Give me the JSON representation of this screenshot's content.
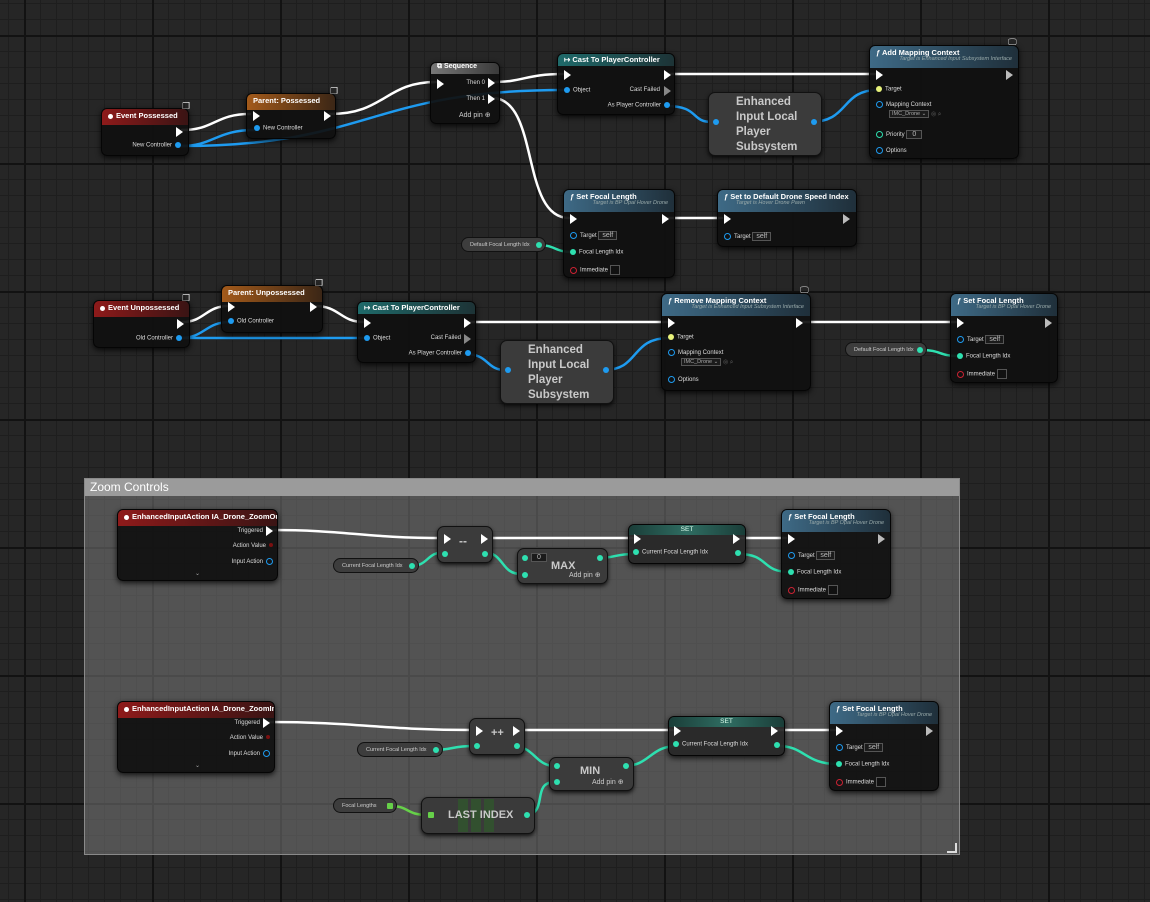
{
  "comment": {
    "title": "Zoom Controls"
  },
  "icons": {
    "event_corner": "blueprint-doc-icon",
    "network": "monitor-icon"
  },
  "possessed": {
    "event": {
      "title": "Event Possessed",
      "pin_new_controller": "New Controller"
    },
    "parent": {
      "title": "Parent: Possessed",
      "pin_new_controller": "New Controller"
    },
    "sequence": {
      "title": "Sequence",
      "then0": "Then 0",
      "then1": "Then 1",
      "add_pin": "Add pin"
    },
    "cast": {
      "title": "Cast To PlayerController",
      "object": "Object",
      "cast_failed": "Cast Failed",
      "as_pc": "As Player Controller"
    },
    "subsystem": {
      "label": "Enhanced Input Local Player Subsystem"
    },
    "add_mapping": {
      "title": "Add Mapping Context",
      "subtitle": "Target is Enhanced Input Subsystem Interface",
      "target": "Target",
      "mapping_context": "Mapping Context",
      "mapping_value": "IMC_Drone",
      "priority": "Priority",
      "priority_value": "0",
      "options": "Options"
    },
    "set_focal": {
      "title": "Set Focal Length",
      "subtitle": "Target is BP Opal Hover Drone",
      "target": "Target",
      "target_value": "self",
      "focal_idx": "Focal Length Idx",
      "immediate": "Immediate"
    },
    "default_var": {
      "label": "Default Focal Length Idx"
    },
    "set_speed": {
      "title": "Set to Default Drone Speed Index",
      "subtitle": "Target is Hover Drone Pawn",
      "target": "Target",
      "target_value": "self"
    }
  },
  "unpossessed": {
    "event": {
      "title": "Event Unpossessed",
      "pin_old_controller": "Old Controller"
    },
    "parent": {
      "title": "Parent: Unpossessed",
      "pin_old_controller": "Old Controller"
    },
    "cast": {
      "title": "Cast To PlayerController",
      "object": "Object",
      "cast_failed": "Cast Failed",
      "as_pc": "As Player Controller"
    },
    "subsystem": {
      "label": "Enhanced Input Local Player Subsystem"
    },
    "remove_mapping": {
      "title": "Remove Mapping Context",
      "subtitle": "Target is Enhanced Input Subsystem Interface",
      "target": "Target",
      "mapping_context": "Mapping Context",
      "mapping_value": "IMC_Drone",
      "options": "Options"
    },
    "default_var": {
      "label": "Default Focal Length Idx"
    },
    "set_focal": {
      "title": "Set Focal Length",
      "subtitle": "Target is BP Opal Hover Drone",
      "target": "Target",
      "target_value": "self",
      "focal_idx": "Focal Length Idx",
      "immediate": "Immediate"
    }
  },
  "zoom_out": {
    "event": {
      "title": "EnhancedInputAction IA_Drone_ZoomOut",
      "triggered": "Triggered",
      "action_value": "Action Value",
      "input_action": "Input Action"
    },
    "var": {
      "label": "Current Focal Length Idx"
    },
    "decrement": {
      "label": "--"
    },
    "max": {
      "label": "MAX",
      "value": "0",
      "add_pin": "Add pin"
    },
    "set": {
      "title": "SET",
      "pin": "Current Focal Length Idx"
    },
    "set_focal": {
      "title": "Set Focal Length",
      "subtitle": "Target is BP Opal Hover Drone",
      "target": "Target",
      "target_value": "self",
      "focal_idx": "Focal Length Idx",
      "immediate": "Immediate"
    }
  },
  "zoom_in": {
    "event": {
      "title": "EnhancedInputAction IA_Drone_ZoomIn",
      "triggered": "Triggered",
      "action_value": "Action Value",
      "input_action": "Input Action"
    },
    "var": {
      "label": "Current Focal Length Idx"
    },
    "focal_lengths": {
      "label": "Focal Lengths"
    },
    "increment": {
      "label": "++"
    },
    "last_index": {
      "label": "LAST INDEX"
    },
    "min": {
      "label": "MIN",
      "add_pin": "Add pin"
    },
    "set": {
      "title": "SET",
      "pin": "Current Focal Length Idx"
    },
    "set_focal": {
      "title": "Set Focal Length",
      "subtitle": "Target is BP Opal Hover Drone",
      "target": "Target",
      "target_value": "self",
      "focal_idx": "Focal Length Idx",
      "immediate": "Immediate"
    }
  },
  "colors": {
    "exec": "#ffffff",
    "object": "#1e9bf0",
    "integer": "#2ee0b0",
    "array": "#66d049",
    "event_header": "#8e1a1a",
    "parent_header": "#a35a1a",
    "cast_header": "#1f6a6a",
    "function_header": "#3e6a86"
  }
}
